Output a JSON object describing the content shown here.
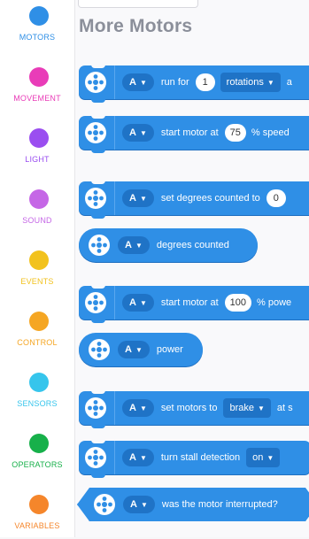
{
  "sidebar": {
    "items": [
      {
        "label": "MOTORS",
        "color": "#2f8fe6"
      },
      {
        "label": "MOVEMENT",
        "color": "#e93cb8"
      },
      {
        "label": "LIGHT",
        "color": "#9a4ef0"
      },
      {
        "label": "SOUND",
        "color": "#c567e6"
      },
      {
        "label": "EVENTS",
        "color": "#f2c21d"
      },
      {
        "label": "CONTROL",
        "color": "#f5a623"
      },
      {
        "label": "SENSORS",
        "color": "#36c5ec"
      },
      {
        "label": "OPERATORS",
        "color": "#17b04a"
      },
      {
        "label": "VARIABLES",
        "color": "#f5862b"
      }
    ]
  },
  "palette": {
    "section_title": "More Motors",
    "blocks": {
      "run_for": {
        "port": "A",
        "text": "run for",
        "value": "1",
        "unit": "rotations",
        "tail": "a"
      },
      "start_speed": {
        "port": "A",
        "text": "start motor at",
        "value": "75",
        "suffix": "% speed"
      },
      "set_degrees": {
        "port": "A",
        "text": "set degrees counted to",
        "value": "0"
      },
      "degrees_counted": {
        "port": "A",
        "text": "degrees counted"
      },
      "start_power": {
        "port": "A",
        "text": "start motor at",
        "value": "100",
        "suffix": "% powe"
      },
      "power": {
        "port": "A",
        "text": "power"
      },
      "set_motors": {
        "port": "A",
        "text": "set motors to",
        "value": "brake",
        "suffix": "at s"
      },
      "stall": {
        "port": "A",
        "text": "turn stall detection",
        "value": "on"
      },
      "interrupted": {
        "port": "A",
        "text": "was the motor interrupted?"
      }
    }
  },
  "colors": {
    "block": "#2f8fe6",
    "block_dark": "#1f73c6",
    "title": "#8b8f9a"
  },
  "icons": {
    "motor": "motor-icon",
    "caret": "▼"
  }
}
